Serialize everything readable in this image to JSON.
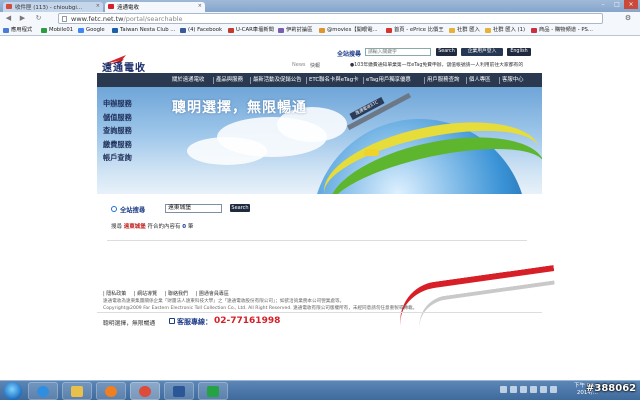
{
  "browser": {
    "tabs": [
      {
        "title": "收件匣 (113) - chioubgi...",
        "close": "×",
        "state": "inactive",
        "icon_color": "#d44b3a"
      },
      {
        "title": "遠通電收",
        "close": "×",
        "state": "active",
        "icon_color": "#d61f26"
      }
    ],
    "window_controls": {
      "minimize": "–",
      "maximize": "□",
      "close": "×"
    },
    "address": {
      "prefix": "www.fetc.net.tw",
      "path": "/portal/searchable"
    },
    "nav": {
      "back": "◀",
      "forward": "▶",
      "reload": "↻"
    },
    "wrench": "⚙",
    "bookmarks": [
      {
        "label": "應用程式",
        "color": "#4a7bd8"
      },
      {
        "label": "Mobile01",
        "color": "#2a9d3d"
      },
      {
        "label": "Google",
        "color": "#4285f4"
      },
      {
        "label": "Taiwan Nesta Club ...",
        "color": "#1b5fa8"
      },
      {
        "label": "(4) Facebook",
        "color": "#3b5998"
      },
      {
        "label": "U-CAR車壇新聞",
        "color": "#c23b2b"
      },
      {
        "label": "伊莉討論區",
        "color": "#7a5fb0"
      },
      {
        "label": "@movies【開眼電...",
        "color": "#e0952c"
      },
      {
        "label": "首頁 - ePrice 比價王",
        "color": "#d8342c"
      },
      {
        "label": "社群 匯入",
        "color": "#e6b23a"
      },
      {
        "label": "社群 匯入 (1)",
        "color": "#e6b23a"
      },
      {
        "label": "商品 - 購物頻道 - PS...",
        "color": "#c8323f"
      }
    ]
  },
  "site": {
    "logo": {
      "text": "遠通電收",
      "color": "#d61f26"
    },
    "header_search": {
      "label": "全站搜尋",
      "placeholder": "請輸入關鍵字",
      "button": "Search"
    },
    "login_button": "企業用戶登入",
    "english_button": "English",
    "news_label": "News",
    "quick_label": "快報",
    "marquee": "●103年繳費通知單業第一年eTag免費申辦，儲值帳號請一人利用前往大家都有的",
    "menu": [
      "關於遠通電收",
      "產品與服務",
      "最新活動及促銷公告",
      "ETC聯名卡與eTag卡",
      "eTag用戶獨享優惠",
      "用戶服務查詢",
      "個人專區",
      "客服中心"
    ],
    "side_menu": [
      "申辦服務",
      "儲值服務",
      "查詢服務",
      "繳費服務",
      "帳戶查詢"
    ],
    "slogan": "聰明選擇，無限暢通",
    "gantry_sign": "遠通電收ETC",
    "search": {
      "title": "全站搜尋",
      "value": "遠東城堡",
      "button": "Search",
      "result_prefix": "搜尋",
      "keyword": "遠東城堡",
      "result_mid": "符合的內容有",
      "count": "0",
      "result_suffix": "筆"
    },
    "footer": {
      "links": [
        "| 隱私政策",
        "| 網站導覽",
        "| 聯絡我們",
        "| 團通會員專區"
      ],
      "copyright1": "遠通電收為遠東集團關係企業「財團法人遠東科技大學」之「遠通電收股份有限公司」；如欲洽詢業務本公司營業處等。",
      "copyright2": "Copyright@2009 Far Eastern Electronic Toll Collection Co., Ltd. All Right Reserved. 遠通電收有限公司版權所有，未經同意請勿任意重製或轉載。",
      "slogan": "聰明選擇，無限暢通",
      "hotline_label": "客服專線：",
      "hotline_number": "02-77161998"
    }
  },
  "taskbar": {
    "apps": [
      {
        "name": "ie",
        "color": "#2f8ee0"
      },
      {
        "name": "explorer",
        "color": "#e8c14a"
      },
      {
        "name": "media",
        "color": "#f07f21"
      },
      {
        "name": "chrome",
        "color": "#dd4b39"
      },
      {
        "name": "word",
        "color": "#2b5797"
      },
      {
        "name": "line",
        "color": "#25a244"
      }
    ],
    "clock_time": "下午 09:...",
    "clock_date": "2014/..."
  },
  "watermark": "#388062"
}
